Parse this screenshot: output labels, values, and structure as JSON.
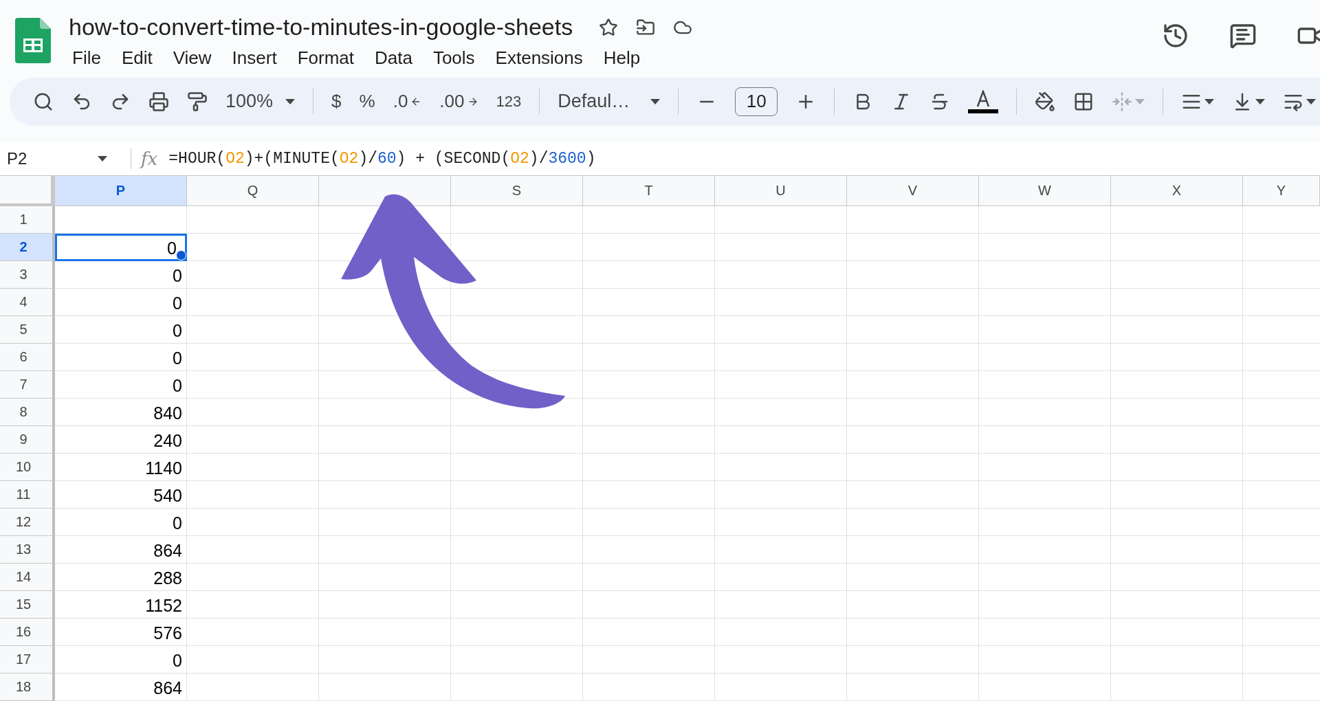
{
  "document": {
    "title": "how-to-convert-time-to-minutes-in-google-sheets"
  },
  "menu": [
    "File",
    "Edit",
    "View",
    "Insert",
    "Format",
    "Data",
    "Tools",
    "Extensions",
    "Help"
  ],
  "toolbar": {
    "zoom": "100%",
    "currency": "$",
    "percent": "%",
    "decrease_decimals": ".0",
    "increase_decimals": ".00",
    "number_format": "123",
    "font": "Defaul…",
    "font_size": "10",
    "merge_disabled": true
  },
  "name_box": "P2",
  "fx_label": "fx",
  "formula": [
    {
      "kind": "text",
      "text": "=HOUR("
    },
    {
      "kind": "ref",
      "text": "O2"
    },
    {
      "kind": "text",
      "text": ")+(MINUTE("
    },
    {
      "kind": "ref",
      "text": "O2"
    },
    {
      "kind": "text",
      "text": ")/"
    },
    {
      "kind": "num",
      "text": "60"
    },
    {
      "kind": "text",
      "text": ") + (SECOND("
    },
    {
      "kind": "ref",
      "text": "O2"
    },
    {
      "kind": "text",
      "text": ")/"
    },
    {
      "kind": "num",
      "text": "3600"
    },
    {
      "kind": "text",
      "text": ")"
    }
  ],
  "columns": [
    {
      "label": "P",
      "selected": true
    },
    {
      "label": "Q",
      "selected": false
    },
    {
      "selected": false
    },
    {
      "label": "S",
      "selected": false
    },
    {
      "label": "T",
      "selected": false
    },
    {
      "label": "U",
      "selected": false
    },
    {
      "label": "V",
      "selected": false
    },
    {
      "label": "W",
      "selected": false
    },
    {
      "label": "X",
      "selected": false
    },
    {
      "label": "Y",
      "selected": false
    }
  ],
  "rows": [
    {
      "number": "1",
      "selected": false
    },
    {
      "number": "2",
      "selected": true,
      "value": "0"
    },
    {
      "number": "3",
      "selected": false,
      "value": "0"
    },
    {
      "number": "4",
      "selected": false,
      "value": "0"
    },
    {
      "number": "5",
      "selected": false,
      "value": "0"
    },
    {
      "number": "6",
      "selected": false,
      "value": "0"
    },
    {
      "number": "7",
      "selected": false,
      "value": "0"
    },
    {
      "number": "8",
      "selected": false,
      "value": "840"
    },
    {
      "number": "9",
      "selected": false,
      "value": "240"
    },
    {
      "number": "10",
      "selected": false,
      "value": "1140"
    },
    {
      "number": "11",
      "selected": false,
      "value": "540"
    },
    {
      "number": "12",
      "selected": false,
      "value": "0"
    },
    {
      "number": "13",
      "selected": false,
      "value": "864"
    },
    {
      "number": "14",
      "selected": false,
      "value": "288"
    },
    {
      "number": "15",
      "selected": false,
      "value": "1152"
    },
    {
      "number": "16",
      "selected": false,
      "value": "576"
    },
    {
      "number": "17",
      "selected": false,
      "value": "0"
    },
    {
      "number": "18",
      "selected": false,
      "value": "864"
    }
  ]
}
